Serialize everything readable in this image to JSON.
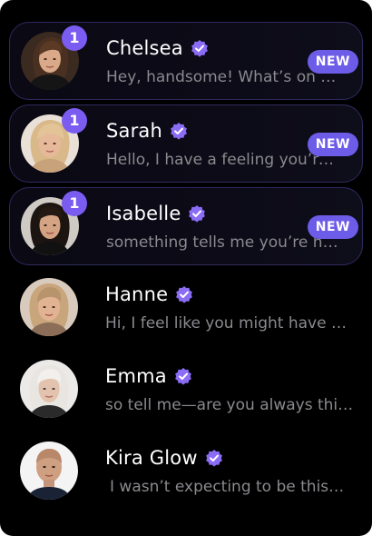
{
  "chats": [
    {
      "name": "Chelsea",
      "preview": "Hey, handsome! What’s on your mind today?",
      "unread_count": "1",
      "new_label": "NEW"
    },
    {
      "name": "Sarah",
      "preview": "Hello, I have a feeling you’re someone special",
      "unread_count": "1",
      "new_label": "NEW"
    },
    {
      "name": "Isabelle",
      "preview": "something tells me you’re hot and full of surprises",
      "unread_count": "1",
      "new_label": "NEW"
    },
    {
      "name": "Hanne",
      "preview": "Hi, I feel like you might have a story to tell"
    },
    {
      "name": "Emma",
      "preview": "so tell me—are you always this charming"
    },
    {
      "name": "Kira Glow",
      "preview": "I wasn’t expecting to be this curious about you"
    }
  ],
  "colors": {
    "accent": "#7b5cf0",
    "new_badge": "#6d5ce8",
    "preview_text": "#8a8a8f",
    "background": "#000000"
  },
  "icons": {
    "verified": "verified-check-icon"
  }
}
